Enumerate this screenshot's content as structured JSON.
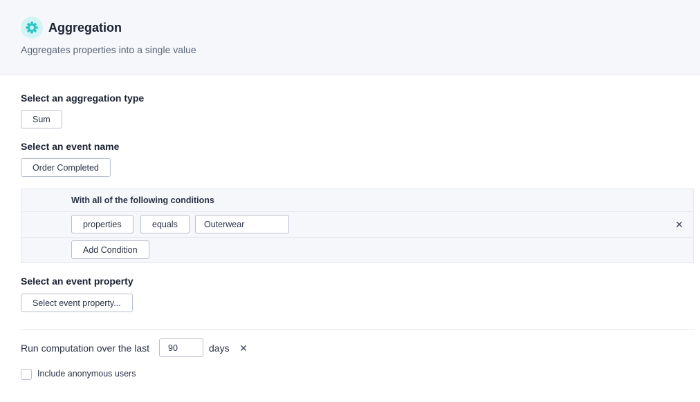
{
  "header": {
    "icon": "gear-icon",
    "title": "Aggregation",
    "subtitle": "Aggregates properties into a single value"
  },
  "aggregation_type": {
    "label": "Select an aggregation type",
    "value": "Sum"
  },
  "event_name": {
    "label": "Select an event name",
    "value": "Order Completed"
  },
  "conditions": {
    "header": "With all of the following conditions",
    "rows": [
      {
        "property": "properties",
        "operator": "equals",
        "value": "Outerwear",
        "remove_icon": "close-icon"
      }
    ],
    "add_label": "Add Condition"
  },
  "event_property": {
    "label": "Select an event property",
    "placeholder": "Select event property..."
  },
  "computation": {
    "prefix": "Run computation over the last",
    "value": "90",
    "suffix": "days",
    "remove_icon": "close-icon"
  },
  "anonymous": {
    "label": "Include anonymous users",
    "checked": false
  },
  "colors": {
    "header_bg": "#f6f7fb",
    "icon_bg": "#d3f4f4",
    "icon_fg": "#2cc3c3",
    "border": "#b9bfcc"
  }
}
